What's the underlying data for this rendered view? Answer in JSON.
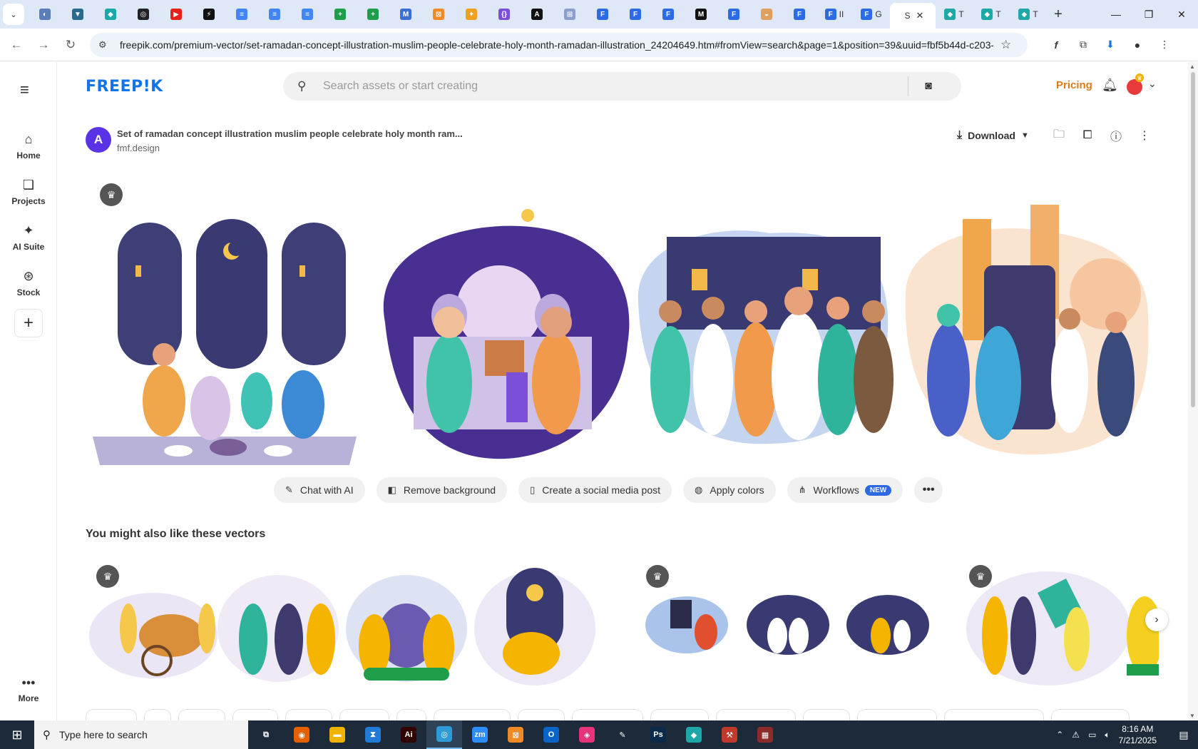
{
  "browser": {
    "active_tab": {
      "title": "S",
      "close": "✕"
    },
    "tabs": [
      {
        "fav": "◐",
        "color": "#5b7db8"
      },
      {
        "fav": "▼",
        "color": "#2b6a8e"
      },
      {
        "fav": "◆",
        "color": "#1ea7a7"
      },
      {
        "fav": "◎",
        "color": "#222222"
      },
      {
        "fav": "▶",
        "color": "#e62117"
      },
      {
        "fav": "⚡",
        "color": "#111111"
      },
      {
        "fav": "≡",
        "color": "#4285f4"
      },
      {
        "fav": "≡",
        "color": "#4285f4"
      },
      {
        "fav": "≡",
        "color": "#4285f4"
      },
      {
        "fav": "+",
        "color": "#1e9e4a"
      },
      {
        "fav": "+",
        "color": "#1e9e4a"
      },
      {
        "fav": "M",
        "color": "#3b6fd4"
      },
      {
        "fav": "⊠",
        "color": "#f08a24"
      },
      {
        "fav": "✦",
        "color": "#f0a020"
      },
      {
        "fav": "{}",
        "color": "#7b4fd6"
      },
      {
        "fav": "A",
        "color": "#111111"
      },
      {
        "fav": "⊞",
        "color": "#8a9fd0"
      },
      {
        "fav": "F",
        "color": "#2d6be4"
      },
      {
        "fav": "F",
        "color": "#2d6be4"
      },
      {
        "fav": "F",
        "color": "#2d6be4"
      },
      {
        "fav": "M",
        "color": "#111111"
      },
      {
        "fav": "F",
        "color": "#2d6be4"
      },
      {
        "fav": "◒",
        "color": "#e0a060"
      },
      {
        "fav": "F",
        "color": "#2d6be4"
      },
      {
        "fav": "F",
        "color": "#2d6be4",
        "title": "II"
      },
      {
        "fav": "F",
        "color": "#2d6be4",
        "title": "G"
      }
    ],
    "tabs_after": [
      {
        "fav": "◆",
        "color": "#1ea7a7",
        "title": "T"
      },
      {
        "fav": "◆",
        "color": "#1ea7a7",
        "title": "T"
      },
      {
        "fav": "◆",
        "color": "#1ea7a7",
        "title": "T"
      }
    ],
    "new_tab": "+",
    "window": {
      "minimize": "—",
      "restore": "❐",
      "close": "✕"
    },
    "url": "freepik.com/premium-vector/set-ramadan-concept-illustration-muslim-people-celebrate-holy-month-ramadan-illustration_24204649.htm#fromView=search&page=1&position=39&uuid=fbf5b44d-c203-..."
  },
  "site": {
    "logo": "FREEP!K",
    "search_placeholder": "Search assets or start creating",
    "pricing": "Pricing",
    "nav": [
      {
        "icon": "⌂",
        "label": "Home"
      },
      {
        "icon": "❏",
        "label": "Projects"
      },
      {
        "icon": "✦",
        "label": "AI Suite"
      },
      {
        "icon": "⊛",
        "label": "Stock"
      }
    ],
    "more_label": "More",
    "asset_title": "Set of ramadan concept illustration muslim people celebrate holy month ram...",
    "author": "fmf.design",
    "author_initial": "A",
    "download": "Download",
    "tools": [
      {
        "icon": "✎",
        "label": "Chat with AI"
      },
      {
        "icon": "◧",
        "label": "Remove background"
      },
      {
        "icon": "▯",
        "label": "Create a social media post"
      },
      {
        "icon": "◍",
        "label": "Apply colors"
      },
      {
        "icon": "⋔",
        "label": "Workflows",
        "badge": "NEW"
      }
    ],
    "related_title": "You might also like these vectors"
  },
  "taskbar": {
    "search_text": "Type here to search",
    "time": "8:16 AM",
    "date": "7/21/2025",
    "apps": [
      {
        "label": "⧉",
        "color": "#1c2a3a"
      },
      {
        "label": "◉",
        "color": "#e66000"
      },
      {
        "label": "▬",
        "color": "#f0b400"
      },
      {
        "label": "⧗",
        "color": "#1f7bd6"
      },
      {
        "label": "Ai",
        "color": "#330000"
      },
      {
        "label": "◎",
        "color": "#2e9bd6",
        "active": true
      },
      {
        "label": "zm",
        "color": "#2d8cff"
      },
      {
        "label": "⊠",
        "color": "#f08a24"
      },
      {
        "label": "O",
        "color": "#0a64c8"
      },
      {
        "label": "◈",
        "color": "#e8327a"
      },
      {
        "label": "✎",
        "color": "#1c2a3a"
      },
      {
        "label": "Ps",
        "color": "#0b2a4a"
      },
      {
        "label": "◆",
        "color": "#1ea7a7"
      },
      {
        "label": "⚒",
        "color": "#c0392b"
      },
      {
        "label": "▦",
        "color": "#8e2a2a"
      }
    ]
  }
}
